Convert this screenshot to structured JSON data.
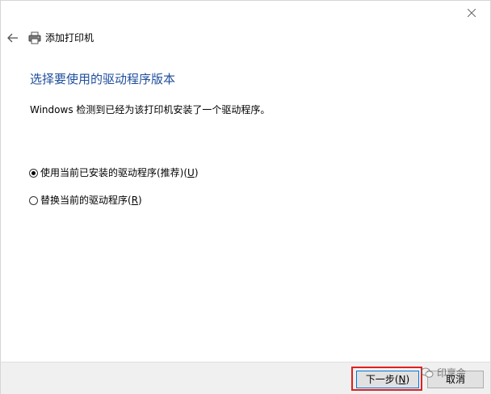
{
  "window": {
    "title": "添加打印机"
  },
  "page": {
    "heading": "选择要使用的驱动程序版本",
    "description": "Windows 检测到已经为该打印机安装了一个驱动程序。"
  },
  "options": [
    {
      "label_before": "使用当前已安装的驱动程序(推荐)(",
      "accel": "U",
      "label_after": ")",
      "selected": true
    },
    {
      "label_before": "替换当前的驱动程序(",
      "accel": "R",
      "label_after": ")",
      "selected": false
    }
  ],
  "footer": {
    "next": {
      "before": "下一步(",
      "accel": "N",
      "after": ")"
    },
    "cancel": "取消"
  },
  "watermark": {
    "text": "印享会"
  },
  "icons": {
    "close": "close-icon",
    "back": "arrow-left-icon",
    "printer": "printer-icon",
    "watermark": "wechat-icon"
  },
  "colors": {
    "heading": "#1f4e9b",
    "footer_bg": "#f0f0f0",
    "button_bg": "#e1e1e1",
    "button_focus_border": "#0078d7",
    "highlight_box": "#e02020"
  }
}
